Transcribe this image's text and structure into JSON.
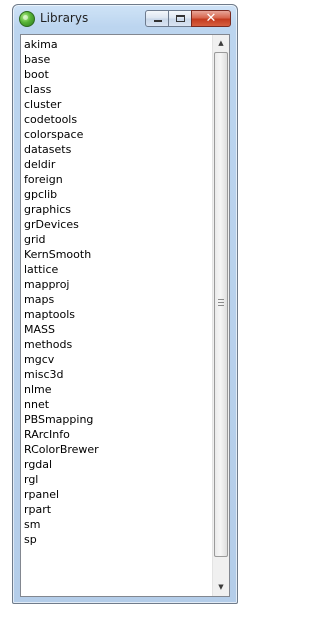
{
  "window": {
    "title": "Librarys",
    "app_icon": "r-globe-icon",
    "buttons": {
      "minimize": "minimize-icon",
      "maximize": "maximize-icon",
      "close_glyph": "✕"
    }
  },
  "listbox": {
    "items": [
      "akima",
      "base",
      "boot",
      "class",
      "cluster",
      "codetools",
      "colorspace",
      "datasets",
      "deldir",
      "foreign",
      "gpclib",
      "graphics",
      "grDevices",
      "grid",
      "KernSmooth",
      "lattice",
      "mapproj",
      "maps",
      "maptools",
      "MASS",
      "methods",
      "mgcv",
      "misc3d",
      "nlme",
      "nnet",
      "PBSmapping",
      "RArcInfo",
      "RColorBrewer",
      "rgdal",
      "rgl",
      "rpanel",
      "rpart",
      "sm",
      "sp"
    ]
  },
  "scrollbar": {
    "up_arrow": "▲",
    "down_arrow": "▼",
    "position": 0
  },
  "colors": {
    "frame": "#bcd5ef",
    "close_button": "#c43b1f",
    "list_background": "#ffffff"
  }
}
